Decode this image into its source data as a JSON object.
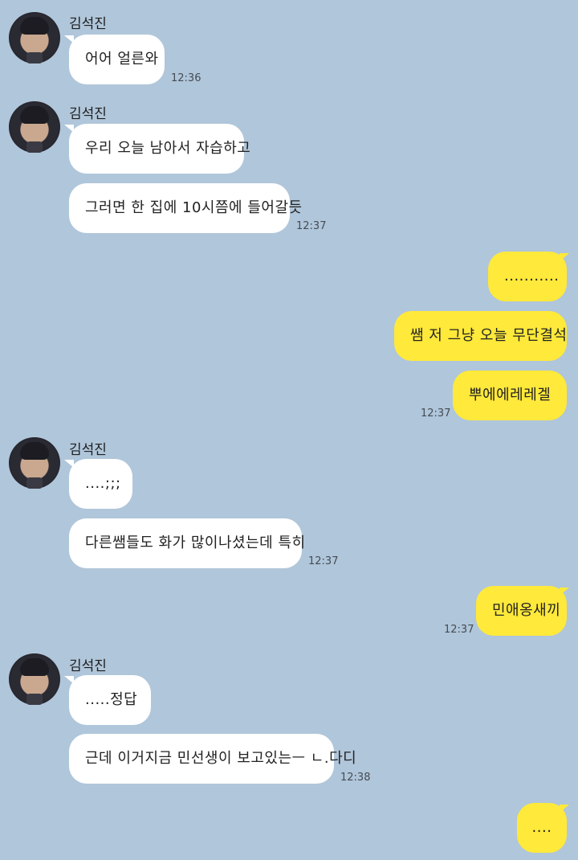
{
  "sender_name": "김석진",
  "messages": {
    "m1": "어어 얼른와",
    "m2": "우리 오늘 남아서 자습하고",
    "m3": "그러면 한 집에 10시쯤에 들어갈듯",
    "m4": "...........",
    "m5": "쌤 저 그냥 오늘 무단결석",
    "m6": "뿌에에레레겔",
    "m7": "....;;;",
    "m8": "다른쌤들도 화가 많이나셨는데 특히",
    "m9": "민애옹새끼",
    "m10": ".....정답",
    "m11": "근데 이거지금 민선생이 보고있는ㅡ ㄴ.다디",
    "m12": "...."
  },
  "times": {
    "t1": "12:36",
    "t2": "12:37",
    "t3": "12:37",
    "t4": "12:37",
    "t5": "12:37",
    "t6": "12:38"
  },
  "colors": {
    "background": "#b0c6da",
    "incoming_bubble": "#ffffff",
    "outgoing_bubble": "#ffe93a"
  }
}
